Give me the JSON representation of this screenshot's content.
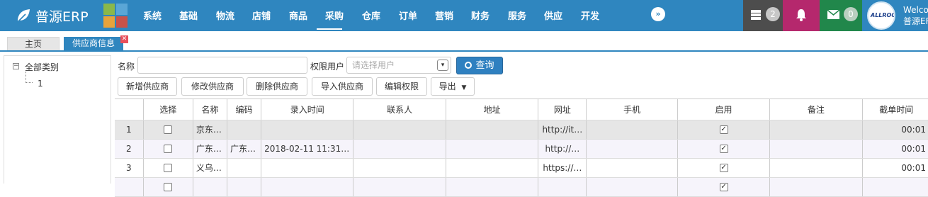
{
  "app": {
    "brand": "普源ERP"
  },
  "nav": {
    "items": [
      "系统",
      "基础",
      "物流",
      "店铺",
      "商品",
      "采购",
      "仓库",
      "订单",
      "营销",
      "财务",
      "服务",
      "供应",
      "开发"
    ],
    "active": "采购"
  },
  "header": {
    "messages_count": "2",
    "mail_count": "0",
    "avatar_text": "ALLROOT",
    "welcome_line1": "Welcome",
    "welcome_line2": "普源ERP"
  },
  "tabs": {
    "home": "主页",
    "suppliers": "供应商信息"
  },
  "tree": {
    "root": "全部类别",
    "child": "1"
  },
  "search": {
    "name_label": "名称",
    "name_value": "",
    "perm_label": "权限用户",
    "perm_placeholder": "请选择用户",
    "query_button": "查询"
  },
  "toolbar": {
    "add": "新增供应商",
    "edit": "修改供应商",
    "delete": "删除供应商",
    "import": "导入供应商",
    "edit_perm": "编辑权限",
    "export": "导出"
  },
  "table": {
    "columns": [
      "",
      "选择",
      "名称",
      "编码",
      "录入时间",
      "联系人",
      "地址",
      "网址",
      "手机",
      "启用",
      "备注",
      "截单时间"
    ],
    "rows": [
      {
        "no": "1",
        "name": "京东…",
        "code": "",
        "time": "",
        "contact": "",
        "address": "",
        "url": "http://it…",
        "phone": "",
        "note": "",
        "cutoff": "00:01"
      },
      {
        "no": "2",
        "name": "广东…",
        "code": "广东…",
        "time": "2018-02-11 11:31:…",
        "contact": "",
        "address": "",
        "url": "http://…",
        "phone": "",
        "note": "",
        "cutoff": "00:01"
      },
      {
        "no": "3",
        "name": "义乌…",
        "code": "",
        "time": "",
        "contact": "",
        "address": "",
        "url": "https://…",
        "phone": "",
        "note": "",
        "cutoff": "00:01"
      }
    ]
  },
  "colors": {
    "topbar": "#2f86bf",
    "query_button": "#2f80c0",
    "msg_box": "#4d4d4d",
    "bell_box": "#b5286d",
    "mail_box": "#21874b"
  },
  "icons": [
    "leaf-icon",
    "app-grid-icon",
    "chevron-double-right-icon",
    "server-icon",
    "bell-icon",
    "envelope-icon",
    "search-icon",
    "caret-down-icon",
    "checkbox-icon"
  ]
}
